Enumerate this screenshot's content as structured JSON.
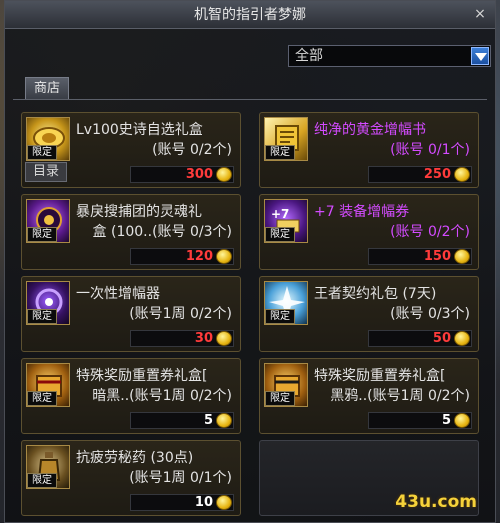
{
  "window": {
    "title": "机智的指引者梦娜",
    "close_glyph": "×"
  },
  "filter": {
    "selected": "全部"
  },
  "tabs": [
    {
      "label": "商店"
    }
  ],
  "catalog_tag": "目录",
  "items": [
    {
      "name": "Lv100史诗自选礼盒",
      "limit": "(账号 0/2个)",
      "price": "300",
      "badge": "限定",
      "price_color": "#ff3b3b",
      "name_color": "white",
      "icon": "epic-box-icon"
    },
    {
      "name": "纯净的黄金增幅书",
      "limit": "(账号 0/1个)",
      "price": "250",
      "badge": "限定",
      "price_color": "#ff3b3b",
      "name_color": "purple",
      "icon": "gold-book-icon"
    },
    {
      "name": "暴戾搜捕团的灵魂礼盒 (100...",
      "name_line1": "暴戾搜捕团的灵魂礼",
      "name_line2": "盒 (100..(账号 0/3个)",
      "limit": "",
      "price": "120",
      "badge": "限定",
      "price_color": "#ff3b3b",
      "name_color": "white",
      "icon": "soul-box-icon"
    },
    {
      "name": "+7 装备增幅券",
      "limit": "(账号 0/2个)",
      "price": "150",
      "badge": "限定",
      "price_color": "#ff3b3b",
      "name_color": "purple",
      "icon": "amplify-ticket-icon"
    },
    {
      "name": "一次性增幅器",
      "limit": "(账号1周 0/2个)",
      "price": "30",
      "badge": "限定",
      "price_color": "#ff3b3b",
      "name_color": "white",
      "icon": "amplifier-icon"
    },
    {
      "name": "王者契约礼包 (7天)",
      "limit": "(账号 0/3个)",
      "price": "50",
      "badge": "限定",
      "price_color": "#ff3b3b",
      "name_color": "white",
      "icon": "contract-pack-icon"
    },
    {
      "name": "特殊奖励重置券礼盒[",
      "name_line2": "暗黑..(账号1周 0/2个)",
      "limit": "",
      "price": "5",
      "badge": "限定",
      "price_color": "#ffffff",
      "name_color": "white",
      "icon": "reset-ticket-box-icon"
    },
    {
      "name": "特殊奖励重置券礼盒[",
      "name_line2": "黑鸦..(账号1周 0/2个)",
      "limit": "",
      "price": "5",
      "badge": "限定",
      "price_color": "#ffffff",
      "name_color": "white",
      "icon": "reset-ticket-box-icon"
    },
    {
      "name": "抗疲劳秘药 (30点)",
      "limit": "(账号1周 0/1个)",
      "price": "10",
      "badge": "限定",
      "price_color": "#ffffff",
      "name_color": "white",
      "icon": "fatigue-potion-icon"
    }
  ],
  "watermark": "43u.com"
}
